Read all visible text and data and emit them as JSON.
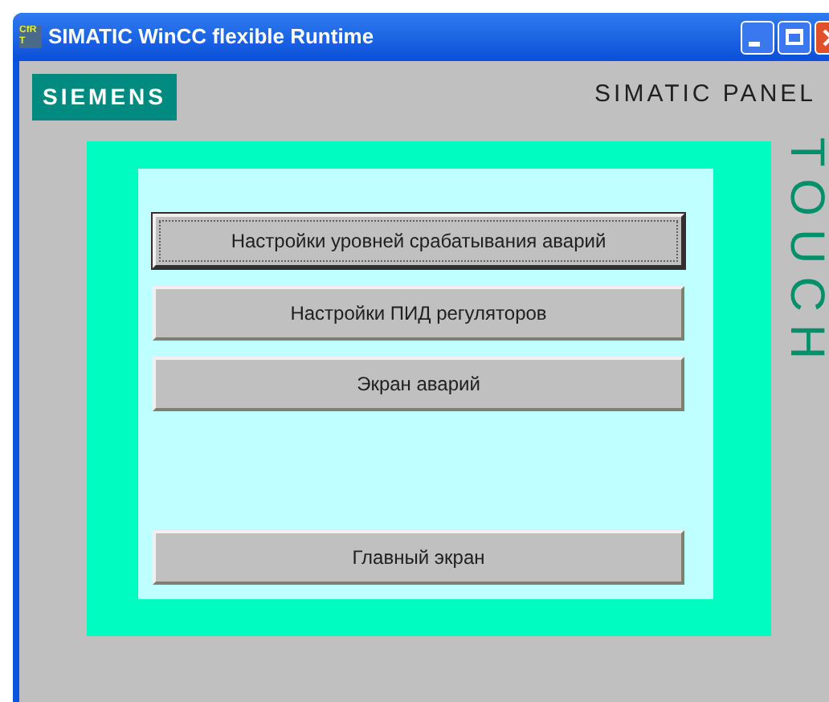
{
  "window": {
    "title": "SIMATIC WinCC flexible Runtime",
    "icon_text": "CfRT"
  },
  "header": {
    "logo": "SIEMENS",
    "panel_label": "SIMATIC PANEL",
    "side_label": "TOUCH"
  },
  "buttons": [
    {
      "label": "Настройки уровней срабатывания аварий",
      "focused": true
    },
    {
      "label": "Настройки ПИД регуляторов",
      "focused": false
    },
    {
      "label": "Экран аварий",
      "focused": false
    }
  ],
  "bottom_button": {
    "label": "Главный экран",
    "focused": false
  }
}
